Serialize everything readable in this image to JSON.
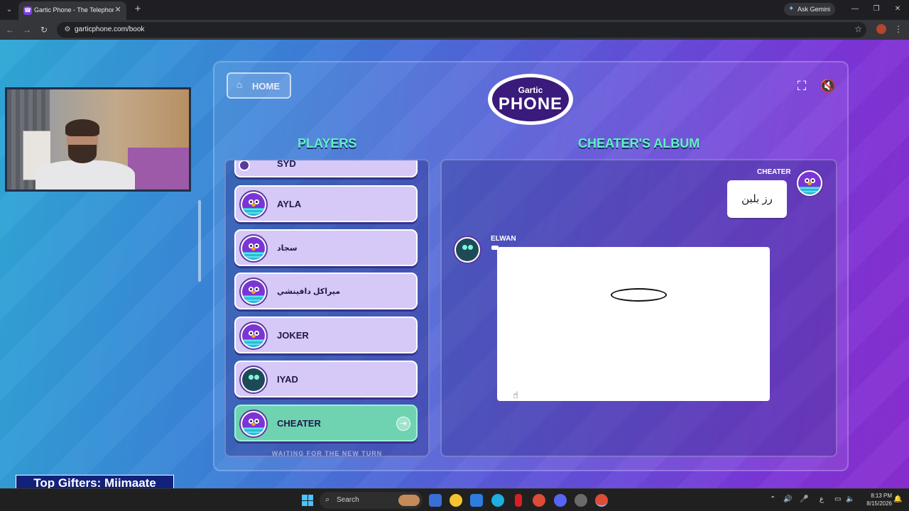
{
  "browser": {
    "tab_title": "Gartic Phone - The Telephone G",
    "url": "garticphone.com/book",
    "gemini_label": "Ask Gemini"
  },
  "stream": {
    "top_gifters": "Top Gifters: Miimaate"
  },
  "game": {
    "home_label": "HOME",
    "logo_top": "Gartic",
    "logo_main": "PHONE",
    "players_title": "PLAYERS",
    "album_title": "CHEATER'S ALBUM",
    "players": [
      {
        "name": "SYD",
        "avatar": "bird"
      },
      {
        "name": "AYLA",
        "avatar": "bird"
      },
      {
        "name": "سجاد",
        "avatar": "bird"
      },
      {
        "name": "ميراكل دافينشي",
        "avatar": "bird"
      },
      {
        "name": "JOKER",
        "avatar": "bird"
      },
      {
        "name": "IYAD",
        "avatar": "ghost"
      },
      {
        "name": "CHEATER",
        "avatar": "bird",
        "current": true
      }
    ],
    "waiting_text": "WAITING FOR THE NEW TURN",
    "album": {
      "entry1_author": "CHEATER",
      "entry1_text": "رز بلبن",
      "entry2_author": "ELWAN"
    }
  },
  "taskbar": {
    "search_label": "Search",
    "time": "8:13 PM",
    "date": "8/15/2026",
    "lang": "ع"
  }
}
